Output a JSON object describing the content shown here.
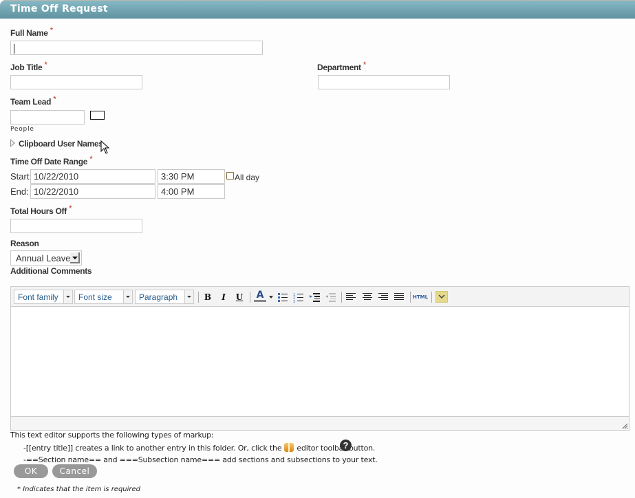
{
  "header": {
    "title": "Time Off Request"
  },
  "colors": {
    "header_top": "#87b8c5",
    "header_bottom": "#5f939f",
    "required": "#c0392b",
    "button": "#999999"
  },
  "fields": {
    "full_name": {
      "label": "Full Name",
      "required_mark": "*",
      "value": ""
    },
    "job_title": {
      "label": "Job Title",
      "required_mark": "*",
      "value": ""
    },
    "department": {
      "label": "Department",
      "required_mark": "*",
      "value": ""
    },
    "team_lead": {
      "label": "Team Lead",
      "required_mark": "*",
      "value": "",
      "hint": "People"
    },
    "clipboard": {
      "label": "Clipboard User Names"
    },
    "date_range": {
      "label": "Time Off Date Range",
      "required_mark": "*",
      "start_label": "Start:",
      "start_date": "10/22/2010",
      "start_time": "3:30 PM",
      "end_label": "End:",
      "end_date": "10/22/2010",
      "end_time": "4:00 PM",
      "all_day_label": "All day",
      "all_day_checked": false
    },
    "total_hours": {
      "label": "Total Hours Off",
      "required_mark": "*",
      "value": ""
    },
    "reason": {
      "label": "Reason",
      "selected": "Annual Leave"
    },
    "comments": {
      "label": "Additional Comments"
    }
  },
  "editor": {
    "font_family": "Font family",
    "font_size": "Font size",
    "format": "Paragraph",
    "buttons": [
      "bold",
      "italic",
      "underline",
      "text-color",
      "bullet-list",
      "numbered-list",
      "indent",
      "outdent",
      "align-left",
      "align-center",
      "align-right",
      "align-justify",
      "html",
      "more"
    ],
    "html_label": "HTML",
    "bold": "B",
    "italic": "I",
    "underline": "U",
    "text_color": "A"
  },
  "markup_help": {
    "intro": "This text editor supports the following types of markup:",
    "line1_pre": "-[[entry title]] creates a link to another entry in this folder. Or, click the",
    "line1_post": "editor toolbar button.",
    "line2": "-==Section name== and ===Subsection name=== add sections and subsections to your text.",
    "help_glyph": "?"
  },
  "actions": {
    "ok": "OK",
    "cancel": "Cancel"
  },
  "footer": {
    "required_note": "* Indicates that the item is required"
  }
}
